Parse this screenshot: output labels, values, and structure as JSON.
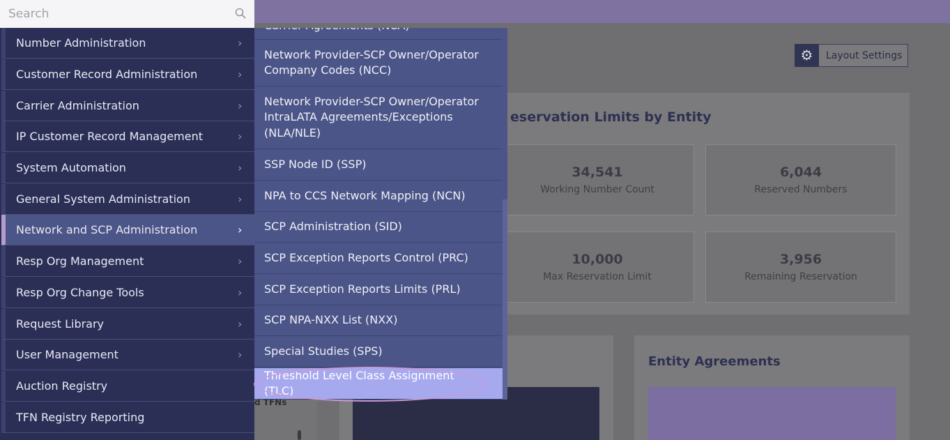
{
  "search": {
    "placeholder": "Search"
  },
  "sidebar": {
    "items": [
      {
        "label": "Number Administration"
      },
      {
        "label": "Customer Record Administration"
      },
      {
        "label": "Carrier Administration"
      },
      {
        "label": "IP Customer Record Management"
      },
      {
        "label": "System Automation"
      },
      {
        "label": "General System Administration"
      },
      {
        "label": "Network and SCP Administration",
        "active": true
      },
      {
        "label": "Resp Org Management"
      },
      {
        "label": "Resp Org Change Tools"
      },
      {
        "label": "Request Library"
      },
      {
        "label": "User Management"
      },
      {
        "label": "Auction Registry"
      },
      {
        "label": "TFN Registry Reporting"
      }
    ]
  },
  "submenu": {
    "items": [
      {
        "label": "Carrier Agreements (NCA)"
      },
      {
        "label": "Network Provider-SCP Owner/Operator Company Codes (NCC)"
      },
      {
        "label": "Network Provider-SCP Owner/Operator IntraLATA Agreements/Exceptions (NLA/NLE)"
      },
      {
        "label": "SSP Node ID (SSP)"
      },
      {
        "label": "NPA to CCS Network Mapping (NCN)"
      },
      {
        "label": "SCP Administration (SID)"
      },
      {
        "label": "SCP Exception Reports Control (PRC)"
      },
      {
        "label": "SCP Exception Reports Limits (PRL)"
      },
      {
        "label": "SCP NPA-NXX List (NXX)"
      },
      {
        "label": "Special Studies (SPS)"
      },
      {
        "label": "Threshold Level Class Assignment (TLC)",
        "highlighted": true
      }
    ]
  },
  "dashboard": {
    "layout_settings": "Layout Settings",
    "reservation_title": "eservation Limits by Entity",
    "stats": [
      {
        "value": "34,541",
        "caption": "Working Number Count"
      },
      {
        "value": "6,044",
        "caption": "Reserved Numbers"
      },
      {
        "value": "10,000",
        "caption": "Max Reservation Limit"
      },
      {
        "value": "3,956",
        "caption": "Remaining Reservation"
      }
    ],
    "agreements_title": "Entity Agreements",
    "partial_text": "d TFNs"
  },
  "colors": {
    "sidebar_bg": "#2a2e54",
    "submenu_bg": "#4c5587",
    "highlight": "#a7a9ef",
    "accent_purple": "#7c6ea0"
  }
}
